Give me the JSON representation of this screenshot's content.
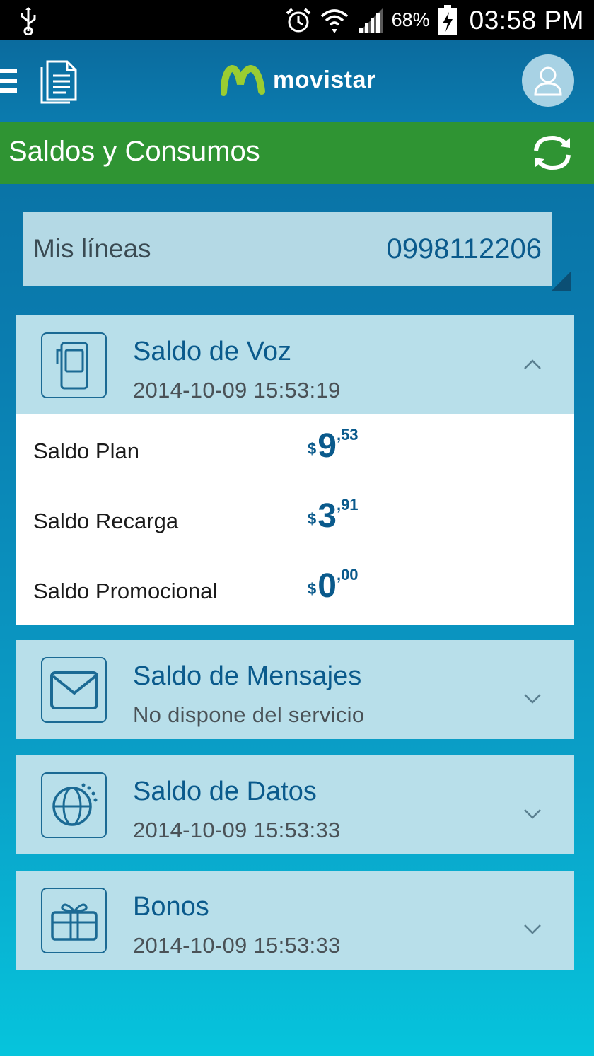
{
  "status_bar": {
    "battery_percent": "68%",
    "time": "03:58 PM",
    "icons": [
      "usb-icon",
      "alarm-icon",
      "wifi-icon",
      "signal-icon",
      "battery-charging-icon"
    ]
  },
  "app_bar": {
    "brand": "movistar",
    "icons": [
      "menu-icon",
      "document-icon",
      "user-icon"
    ]
  },
  "section": {
    "title": "Saldos y Consumos",
    "refresh_icon": "refresh-icon"
  },
  "lines": {
    "label": "Mis líneas",
    "value": "0998112206"
  },
  "cards": [
    {
      "title": "Saldo de Voz",
      "subtitle": "2014-10-09 15:53:19",
      "icon": "phone-icon",
      "expanded": true,
      "balances": [
        {
          "label": "Saldo Plan",
          "currency": "$",
          "integer": "9",
          "decimals": ",53"
        },
        {
          "label": "Saldo Recarga",
          "currency": "$",
          "integer": "3",
          "decimals": ",91"
        },
        {
          "label": "Saldo Promocional",
          "currency": "$",
          "integer": "0",
          "decimals": ",00"
        }
      ]
    },
    {
      "title": "Saldo de Mensajes",
      "subtitle": "No dispone del servicio",
      "icon": "envelope-icon",
      "expanded": false
    },
    {
      "title": "Saldo de Datos",
      "subtitle": "2014-10-09 15:53:33",
      "icon": "globe-icon",
      "expanded": false
    },
    {
      "title": "Bonos",
      "subtitle": "2014-10-09 15:53:33",
      "icon": "gift-icon",
      "expanded": false
    }
  ],
  "colors": {
    "app_bar": "#0b6b9e",
    "section_bar": "#2f9433",
    "card_bg": "#b8dfea",
    "accent_text": "#0a5a8c"
  }
}
